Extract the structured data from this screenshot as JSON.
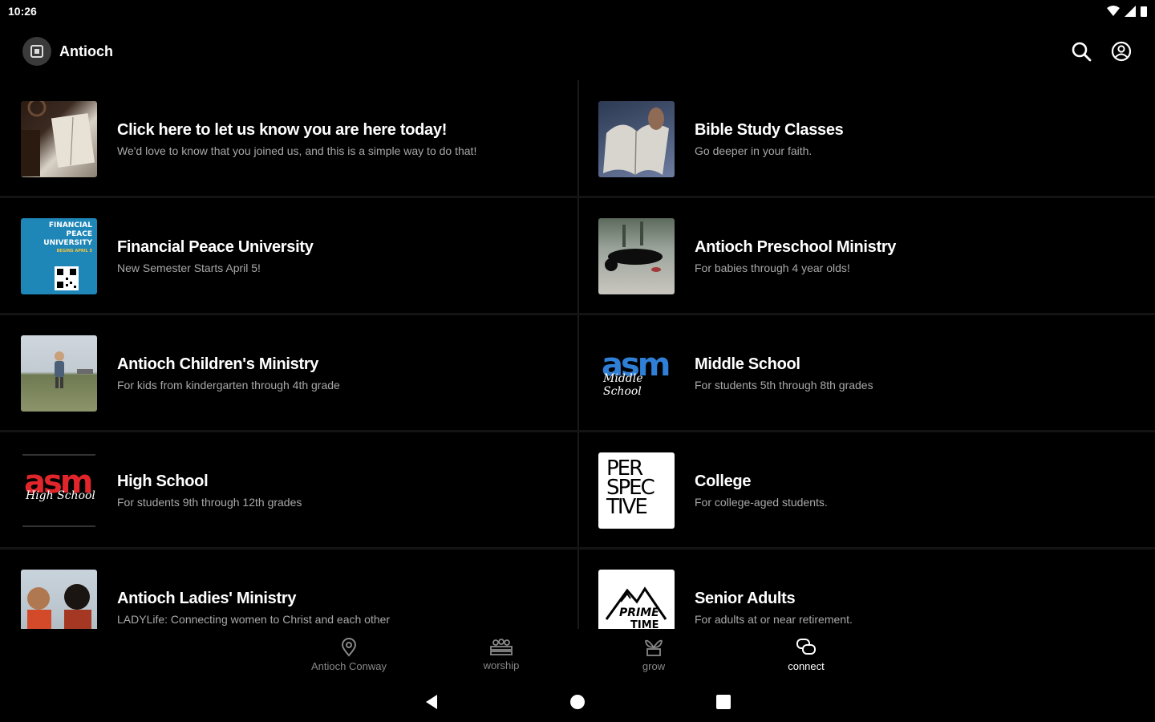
{
  "status_bar": {
    "time": "10:26"
  },
  "app": {
    "title": "Antioch"
  },
  "items": [
    {
      "title": "Click here to let us know you are here today!",
      "subtitle": "We'd love to know that you joined us, and this is a simple way to do that!",
      "image": "bible-with-coffee"
    },
    {
      "title": "Bible Study Classes",
      "subtitle": "Go deeper in your faith.",
      "image": "open-bible"
    },
    {
      "title": "Financial Peace University",
      "subtitle": "New Semester Starts April 5!",
      "image": "financial-peace-flyer",
      "image_text": [
        "FINANCIAL",
        "PEACE",
        "UNIVERSITY",
        "BEGINS APRIL 5"
      ]
    },
    {
      "title": "Antioch Preschool Ministry",
      "subtitle": "For babies through 4 year olds!",
      "image": "toddler-photo"
    },
    {
      "title": "Antioch Children's Ministry",
      "subtitle": "For kids from kindergarten through 4th grade",
      "image": "child-in-field"
    },
    {
      "title": "Middle School",
      "subtitle": "For students 5th through 8th grades",
      "image": "asm-middle-school-logo",
      "image_text": [
        "asm",
        "Middle School"
      ]
    },
    {
      "title": "High School",
      "subtitle": "For students 9th through 12th grades",
      "image": "asm-high-school-logo",
      "image_text": [
        "asm",
        "High School"
      ]
    },
    {
      "title": "College",
      "subtitle": "For college-aged students.",
      "image": "perspective-logo",
      "image_text": [
        "PER",
        "SPEC",
        "TIVE"
      ]
    },
    {
      "title": "Antioch Ladies' Ministry",
      "subtitle": "LADYLife: Connecting women to Christ and each other",
      "image": "women-photo"
    },
    {
      "title": "Senior Adults",
      "subtitle": "For adults at or near retirement.",
      "image": "prime-time-logo",
      "image_text": [
        "PRIME",
        "TIME"
      ]
    }
  ],
  "bottom_nav": [
    {
      "label": "Antioch Conway",
      "icon": "location-pin-icon",
      "active": false
    },
    {
      "label": "worship",
      "icon": "worship-icon",
      "active": false
    },
    {
      "label": "grow",
      "icon": "grow-icon",
      "active": false
    },
    {
      "label": "connect",
      "icon": "chat-icon",
      "active": true
    }
  ],
  "colors": {
    "background": "#000000",
    "subtitle": "#a8a8a8",
    "nav_inactive": "#888888"
  }
}
